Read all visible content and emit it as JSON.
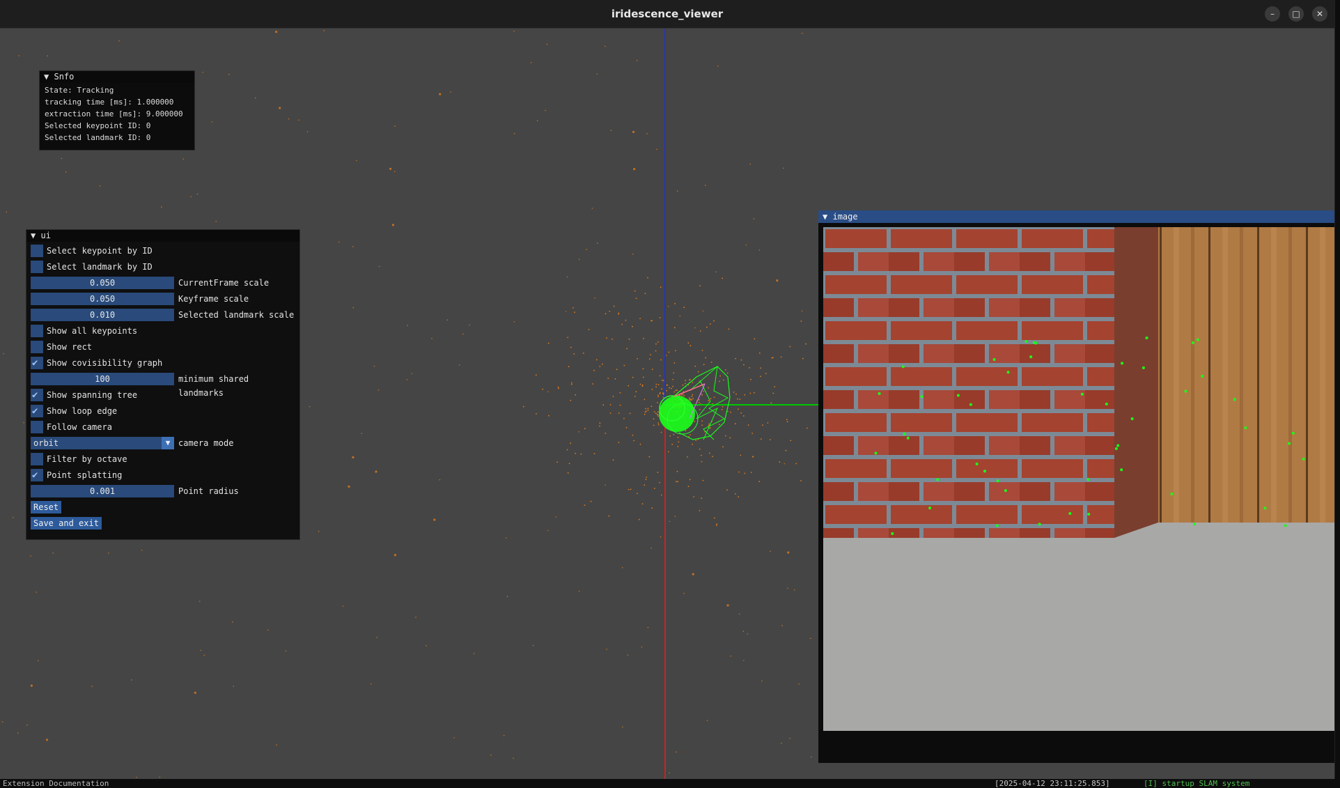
{
  "window": {
    "title": "iridescence_viewer",
    "minimize": "–",
    "maximize": "□",
    "close": "✕"
  },
  "info_panel": {
    "header": "Snfo",
    "lines": [
      "State: Tracking",
      "tracking time [ms]: 1.000000",
      "extraction time [ms]: 9.000000",
      "Selected keypoint ID: 0",
      "Selected landmark ID: 0"
    ]
  },
  "ui_panel": {
    "header": "ui",
    "select_keypoint": {
      "label": "Select keypoint by ID",
      "checked": false
    },
    "select_landmark": {
      "label": "Select landmark by ID",
      "checked": false
    },
    "current_frame_scale": {
      "value": "0.050",
      "label": "CurrentFrame scale"
    },
    "keyframe_scale": {
      "value": "0.050",
      "label": "Keyframe scale"
    },
    "selected_landmark_scale": {
      "value": "0.010",
      "label": "Selected landmark scale"
    },
    "show_all_keypoints": {
      "label": "Show all keypoints",
      "checked": false
    },
    "show_rect": {
      "label": "Show rect",
      "checked": false
    },
    "show_covisibility": {
      "label": "Show covisibility graph",
      "checked": true
    },
    "min_shared": {
      "value": "100",
      "label": "minimum shared landmarks"
    },
    "show_spanning_tree": {
      "label": "Show spanning tree",
      "checked": true
    },
    "show_loop_edge": {
      "label": "Show loop edge",
      "checked": true
    },
    "follow_camera": {
      "label": "Follow camera",
      "checked": false
    },
    "camera_mode": {
      "value": "orbit",
      "label": "camera mode"
    },
    "filter_octave": {
      "label": "Filter by octave",
      "checked": false
    },
    "point_splatting": {
      "label": "Point splatting",
      "checked": true
    },
    "point_radius": {
      "value": "0.001",
      "label": "Point radius"
    },
    "reset_button": "Reset",
    "save_exit_button": "Save and exit"
  },
  "image_window": {
    "header": "image"
  },
  "statusbar": {
    "left": "Extension Documentation",
    "timestamp": "[2025-04-12 23:11:25.853]",
    "message": "[I] startup SLAM system"
  },
  "colors": {
    "background": "#454545",
    "axis_x": "#00c800",
    "axis_y": "#cc2222",
    "axis_z": "#2233cc",
    "landmark": "#e07a1a",
    "keyframe": "#19ff19",
    "panel_accent": "#294a7a"
  }
}
